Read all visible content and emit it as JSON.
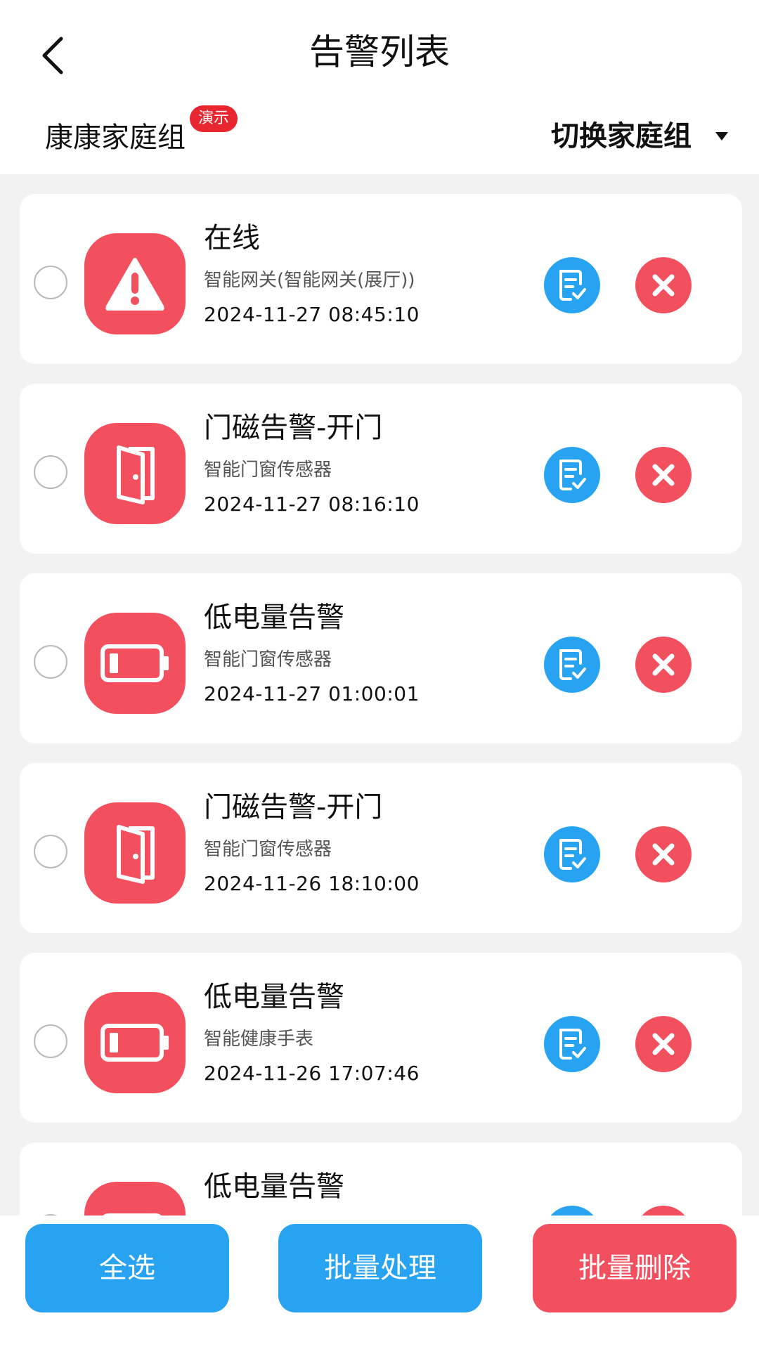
{
  "header": {
    "title": "告警列表",
    "group_name": "康康家庭组",
    "demo_badge": "演示",
    "switch_label": "切换家庭组",
    "icons": {
      "back": "chevron-left-icon",
      "switch": "caret-down-icon"
    }
  },
  "colors": {
    "accent_blue": "#28a3f2",
    "alert_red": "#f3505f",
    "badge_red": "#e8262f",
    "page_bg": "#f2f2f2"
  },
  "alerts": [
    {
      "title": "在线",
      "device": "智能网关(智能网关(展厅))",
      "time": "2024-11-27 08:45:10",
      "icon": "warning-triangle-icon"
    },
    {
      "title": "门磁告警-开门",
      "device": "智能门窗传感器",
      "time": "2024-11-27 08:16:10",
      "icon": "door-open-icon"
    },
    {
      "title": "低电量告警",
      "device": "智能门窗传感器",
      "time": "2024-11-27 01:00:01",
      "icon": "battery-low-icon"
    },
    {
      "title": "门磁告警-开门",
      "device": "智能门窗传感器",
      "time": "2024-11-26 18:10:00",
      "icon": "door-open-icon"
    },
    {
      "title": "低电量告警",
      "device": "智能健康手表",
      "time": "2024-11-26 17:07:46",
      "icon": "battery-low-icon"
    },
    {
      "title": "低电量告警",
      "device": "",
      "time": "",
      "icon": "battery-low-icon"
    }
  ],
  "footer": {
    "select_all": "全选",
    "batch_handle": "批量处理",
    "batch_delete": "批量删除"
  }
}
